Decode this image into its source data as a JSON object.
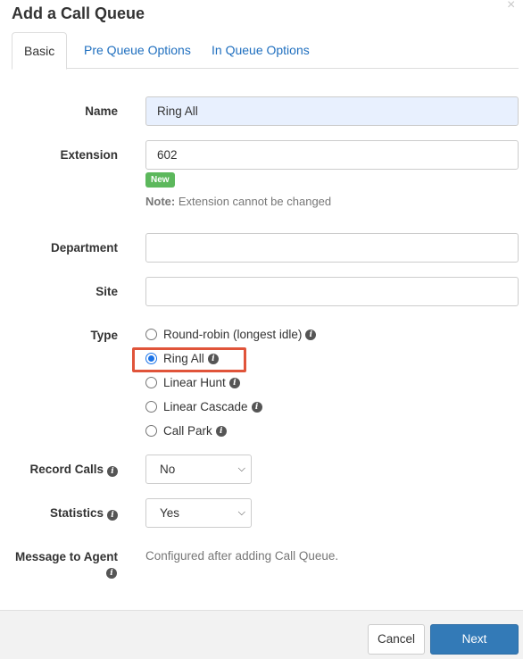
{
  "dialog": {
    "title": "Add a Call Queue",
    "close_glyph": "×"
  },
  "tabs": [
    {
      "label": "Basic",
      "active": true
    },
    {
      "label": "Pre Queue Options",
      "active": false
    },
    {
      "label": "In Queue Options",
      "active": false
    }
  ],
  "form": {
    "name": {
      "label": "Name",
      "value": "Ring All"
    },
    "extension": {
      "label": "Extension",
      "value": "602",
      "badge": "New",
      "note_bold": "Note:",
      "note_text": " Extension cannot be changed"
    },
    "department": {
      "label": "Department",
      "value": ""
    },
    "site": {
      "label": "Site",
      "value": ""
    },
    "type": {
      "label": "Type",
      "options": [
        {
          "label": "Round-robin (longest idle)",
          "checked": false
        },
        {
          "label": "Ring All",
          "checked": true
        },
        {
          "label": "Linear Hunt",
          "checked": false
        },
        {
          "label": "Linear Cascade",
          "checked": false
        },
        {
          "label": "Call Park",
          "checked": false
        }
      ],
      "highlight_color": "#e0543a"
    },
    "record_calls": {
      "label": "Record Calls",
      "value": "No"
    },
    "statistics": {
      "label": "Statistics",
      "value": "Yes"
    },
    "message_to_agent": {
      "label": "Message to Agent",
      "text": "Configured after adding Call Queue."
    }
  },
  "info_glyph": "i",
  "footer": {
    "cancel_label": "Cancel",
    "next_label": "Next"
  },
  "colors": {
    "primary": "#337ab7",
    "link": "#1f6fbf",
    "success": "#5cb85c"
  }
}
